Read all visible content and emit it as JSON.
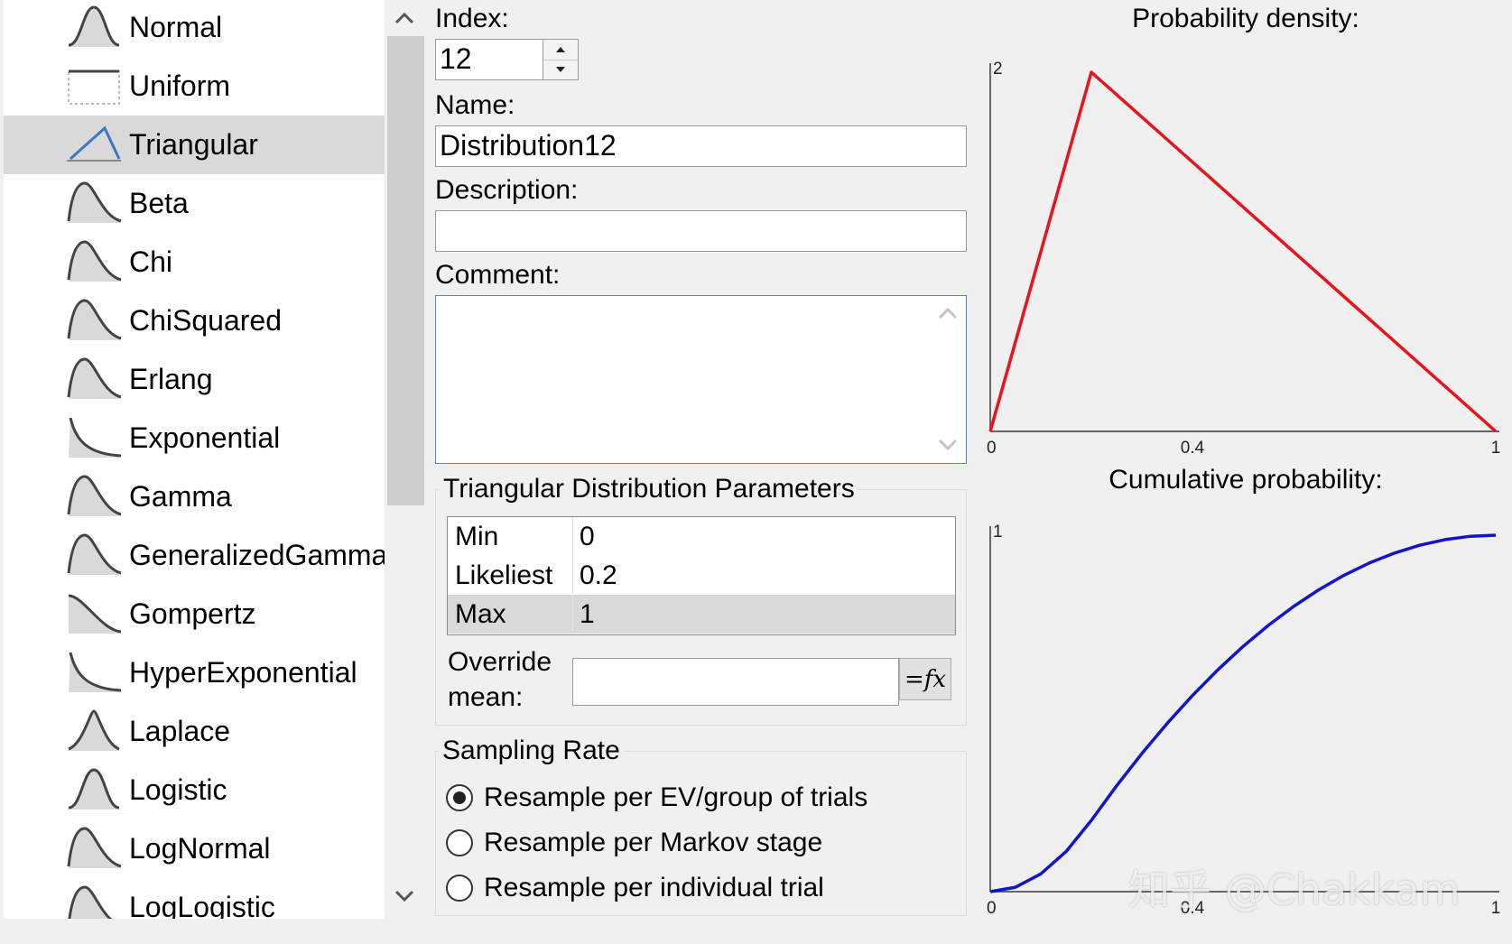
{
  "distributions": [
    {
      "label": "Normal",
      "icon": "normal-curve-icon"
    },
    {
      "label": "Uniform",
      "icon": "uniform-box-icon"
    },
    {
      "label": "Triangular",
      "icon": "triangle-icon"
    },
    {
      "label": "Beta",
      "icon": "beta-curve-icon"
    },
    {
      "label": "Chi",
      "icon": "chi-curve-icon"
    },
    {
      "label": "ChiSquared",
      "icon": "chisquared-curve-icon"
    },
    {
      "label": "Erlang",
      "icon": "erlang-curve-icon"
    },
    {
      "label": "Exponential",
      "icon": "exponential-curve-icon"
    },
    {
      "label": "Gamma",
      "icon": "gamma-curve-icon"
    },
    {
      "label": "GeneralizedGamma",
      "icon": "generalized-gamma-curve-icon"
    },
    {
      "label": "Gompertz",
      "icon": "gompertz-curve-icon"
    },
    {
      "label": "HyperExponential",
      "icon": "hyperexponential-curve-icon"
    },
    {
      "label": "Laplace",
      "icon": "laplace-curve-icon"
    },
    {
      "label": "Logistic",
      "icon": "logistic-curve-icon"
    },
    {
      "label": "LogNormal",
      "icon": "lognormal-curve-icon"
    },
    {
      "label": "LogLogistic",
      "icon": "loglogistic-curve-icon"
    }
  ],
  "selected_distribution": "Triangular",
  "form": {
    "index_label": "Index:",
    "index_value": "12",
    "name_label": "Name:",
    "name_value": "Distribution12",
    "description_label": "Description:",
    "description_value": "",
    "comment_label": "Comment:",
    "comment_value": ""
  },
  "parameters": {
    "title": "Triangular Distribution Parameters",
    "rows": [
      {
        "name": "Min",
        "value": "0"
      },
      {
        "name": "Likeliest",
        "value": "0.2"
      },
      {
        "name": "Max",
        "value": "1"
      }
    ],
    "override_label_line1": "Override",
    "override_label_line2": "mean:",
    "override_value": "",
    "fx_label": "=fx"
  },
  "sampling": {
    "title": "Sampling Rate",
    "options": [
      {
        "label": "Resample per EV/group of trials",
        "checked": true
      },
      {
        "label": "Resample per Markov stage",
        "checked": false
      },
      {
        "label": "Resample per individual trial",
        "checked": false
      }
    ]
  },
  "watermark": "知乎 @Chakkam",
  "chart_data": [
    {
      "type": "line",
      "title": "Probability density:",
      "x": [
        0,
        0.2,
        1
      ],
      "y": [
        0,
        2,
        0
      ],
      "xlim": [
        0,
        1
      ],
      "ylim": [
        0,
        2
      ],
      "xticks": [
        "0",
        "0.4",
        "1"
      ],
      "yticks": [
        "2"
      ],
      "color": "#e8141b"
    },
    {
      "type": "line",
      "title": "Cumulative probability:",
      "x": [
        0,
        0.05,
        0.1,
        0.15,
        0.2,
        0.25,
        0.3,
        0.35,
        0.4,
        0.45,
        0.5,
        0.55,
        0.6,
        0.65,
        0.7,
        0.75,
        0.8,
        0.85,
        0.9,
        0.95,
        1
      ],
      "y": [
        0,
        0.0125,
        0.05,
        0.1125,
        0.2,
        0.2969,
        0.3875,
        0.4719,
        0.55,
        0.6219,
        0.6875,
        0.7469,
        0.8,
        0.8469,
        0.8875,
        0.9219,
        0.95,
        0.9719,
        0.9875,
        0.9969,
        1
      ],
      "xlim": [
        0,
        1
      ],
      "ylim": [
        0,
        1
      ],
      "xticks": [
        "0",
        "0.4",
        "1"
      ],
      "yticks": [
        "1"
      ],
      "color": "#1414c8"
    }
  ]
}
